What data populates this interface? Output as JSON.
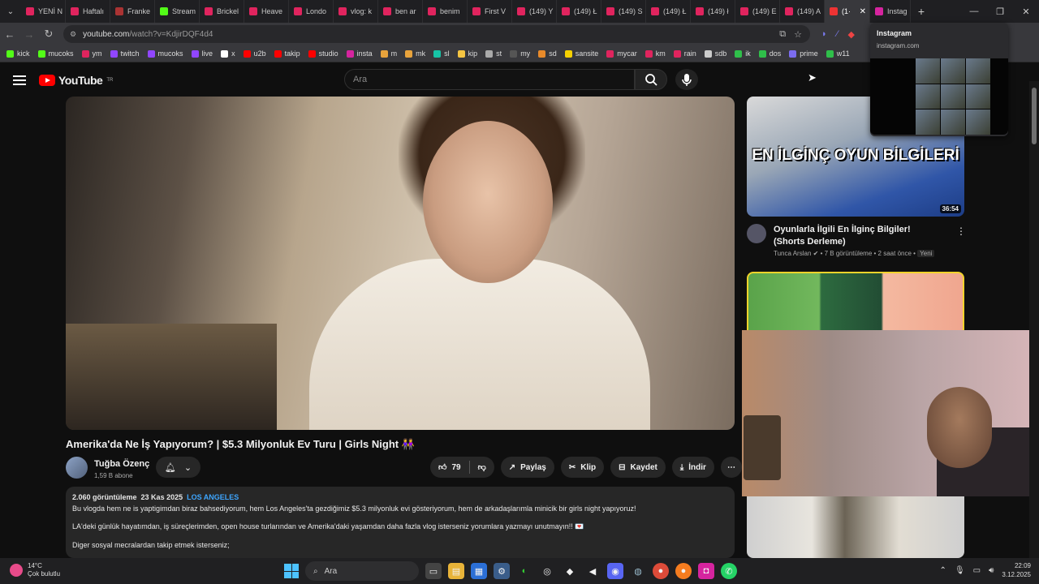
{
  "tabs": [
    {
      "label": "YENİ N",
      "color": "#e0245e"
    },
    {
      "label": "Haftalı",
      "color": "#e0245e"
    },
    {
      "label": "Franke",
      "color": "#a33"
    },
    {
      "label": "Stream",
      "color": "#53fc18"
    },
    {
      "label": "Brickel",
      "color": "#e0245e"
    },
    {
      "label": "Heave",
      "color": "#e0245e"
    },
    {
      "label": "Londo",
      "color": "#e0245e"
    },
    {
      "label": "vlog: k",
      "color": "#e0245e"
    },
    {
      "label": "ben ar",
      "color": "#e0245e"
    },
    {
      "label": "benim",
      "color": "#e0245e"
    },
    {
      "label": "First V",
      "color": "#e0245e"
    },
    {
      "label": "(149) Y",
      "color": "#e0245e"
    },
    {
      "label": "(149) Ł",
      "color": "#e0245e"
    },
    {
      "label": "(149) S",
      "color": "#e0245e"
    },
    {
      "label": "(149) Ł",
      "color": "#e0245e"
    },
    {
      "label": "(149) ł",
      "color": "#e0245e"
    },
    {
      "label": "(149) E",
      "color": "#e0245e"
    },
    {
      "label": "(149) A",
      "color": "#e0245e"
    }
  ],
  "active_tab": {
    "label": "(1·"
  },
  "insta_tab": {
    "label": "Instag"
  },
  "address": {
    "host": "youtube.com",
    "path": "/watch?v=KdjirDQF4d4"
  },
  "bookmarks": [
    {
      "label": "kick",
      "color": "#53fc18"
    },
    {
      "label": "mucoks",
      "color": "#53fc18"
    },
    {
      "label": "ym",
      "color": "#e0245e"
    },
    {
      "label": "twitch",
      "color": "#9146ff"
    },
    {
      "label": "mucoks",
      "color": "#9146ff"
    },
    {
      "label": "live",
      "color": "#9146ff"
    },
    {
      "label": "x",
      "color": "#ffffff"
    },
    {
      "label": "u2b",
      "color": "#ff0000"
    },
    {
      "label": "takip",
      "color": "#ff0000"
    },
    {
      "label": "studio",
      "color": "#ff0000"
    },
    {
      "label": "insta",
      "color": "#d6249f"
    },
    {
      "label": "m",
      "color": "#e8a33c"
    },
    {
      "label": "mk",
      "color": "#e8a33c"
    },
    {
      "label": "sl",
      "color": "#16c3a6"
    },
    {
      "label": "kip",
      "color": "#f5c542"
    },
    {
      "label": "st",
      "color": "#aaaaaa"
    },
    {
      "label": "my",
      "color": "#555555"
    },
    {
      "label": "sd",
      "color": "#e88a2a"
    },
    {
      "label": "sansite",
      "color": "#f5d000"
    },
    {
      "label": "mycar",
      "color": "#e0245e"
    },
    {
      "label": "km",
      "color": "#e0245e"
    },
    {
      "label": "rain",
      "color": "#e0245e"
    },
    {
      "label": "sdb",
      "color": "#cccccc"
    },
    {
      "label": "ik",
      "color": "#2fbf4a"
    },
    {
      "label": "dos",
      "color": "#2fbf4a"
    },
    {
      "label": "prime",
      "color": "#7b6cf0"
    },
    {
      "label": "w11",
      "color": "#2fbf4a"
    }
  ],
  "youtube": {
    "logo_text": "YouTube",
    "logo_sup": "TR",
    "search_placeholder": "Ara"
  },
  "video": {
    "title": "Amerika'da Ne İş Yapıyorum? | $5.3 Milyonluk Ev Turu | Girls Night 👭",
    "channel": "Tuğba Özenç",
    "subscribers": "1,59 B abone",
    "likes": "79",
    "share": "Paylaş",
    "clip": "Klip",
    "save": "Kaydet",
    "download": "İndir",
    "views": "2.060 görüntüleme",
    "date": "23 Kas 2025",
    "location": "LOS ANGELES",
    "desc1": "Bu vlogda hem ne is yaptigimdan biraz bahsediyorum, hem Los Angeles'ta gezdiğimiz $5.3 milyonluk evi gösteriyorum, hem de arkadaşlarımla minicik bir girls night yapıyoruz!",
    "desc2": "LA'deki günlük hayatımdan, iş süreçlerimden, open house turlarından ve Amerika'daki yaşamdan daha fazla vlog isterseniz yorumlara yazmayı unutmayın!! 💌",
    "desc3": "Diger sosyal mecralardan takip etmek isterseniz;"
  },
  "sidebar_video": {
    "thumb_text": "EN İLGİNÇ OYUN BİLGİLERİ",
    "duration": "36:54",
    "title": "Oyunlarla İlgili En İlginç Bilgiler! (Shorts Derleme)",
    "channel": "Tunca Arslan",
    "views": "7 B görüntüleme",
    "age": "2 saat önce",
    "badge": "Yeni"
  },
  "popup": {
    "title": "Instagram",
    "url": "instagram.com"
  },
  "taskbar": {
    "temp": "14°C",
    "weather": "Çok bulutlu",
    "search": "Ara",
    "time": "22:09",
    "date": "3.12.2025"
  }
}
